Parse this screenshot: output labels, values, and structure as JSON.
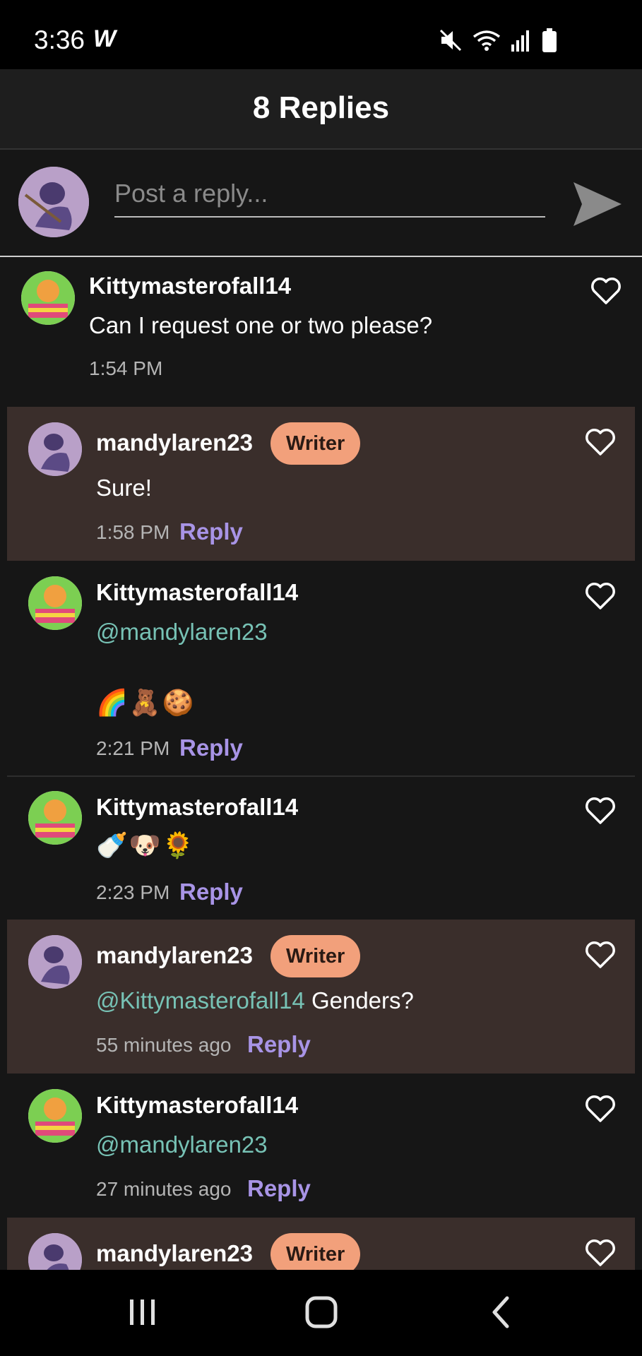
{
  "status_bar": {
    "time": "3:36",
    "app_glyph": "W",
    "icons": [
      "mute-icon",
      "wifi-icon",
      "signal-icon",
      "battery-icon"
    ]
  },
  "header": {
    "title": "8 Replies"
  },
  "composer": {
    "placeholder": "Post a reply...",
    "send_icon": "send-icon"
  },
  "replies": [
    {
      "username": "Kittymasterofall14",
      "badge": "",
      "mention": "",
      "text": "Can I request one or two please?",
      "emoji": "",
      "time": "1:54 PM",
      "reply_label": ""
    },
    {
      "username": "mandylaren23",
      "badge": "Writer",
      "mention": "",
      "text": "Sure!",
      "emoji": "",
      "time": "1:58 PM",
      "reply_label": "Reply"
    },
    {
      "username": "Kittymasterofall14",
      "badge": "",
      "mention": "@mandylaren23",
      "text": "",
      "emoji": "🌈🧸🍪",
      "time": "2:21 PM",
      "reply_label": "Reply"
    },
    {
      "username": "Kittymasterofall14",
      "badge": "",
      "mention": "",
      "text": "",
      "emoji": "🍼🐶🌻",
      "time": "2:23 PM",
      "reply_label": "Reply"
    },
    {
      "username": "mandylaren23",
      "badge": "Writer",
      "mention": "@Kittymasterofall14",
      "text": " Genders?",
      "emoji": "",
      "time": "55 minutes ago",
      "reply_label": "Reply"
    },
    {
      "username": "Kittymasterofall14",
      "badge": "",
      "mention": "@mandylaren23",
      "text": "",
      "emoji": "",
      "time": "27 minutes ago",
      "reply_label": "Reply"
    },
    {
      "username": "mandylaren23",
      "badge": "Writer",
      "mention": "",
      "text": "",
      "emoji": "",
      "time": "",
      "reply_label": ""
    }
  ],
  "colors": {
    "background": "#161616",
    "writer_row": "#3a2e2b",
    "badge": "#f2a07b",
    "mention": "#77c2b5",
    "reply_link": "#a894e6"
  },
  "nav": [
    "recent-apps-icon",
    "home-icon",
    "back-icon"
  ]
}
